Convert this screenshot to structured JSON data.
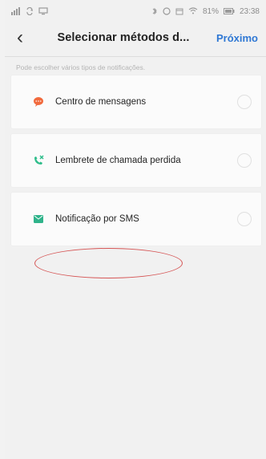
{
  "status_bar": {
    "left_icons": [
      "signal-icon",
      "sync-icon",
      "monitor-icon"
    ],
    "right_icons": [
      "bluetooth-icon",
      "record-icon",
      "calendar-icon",
      "wifi-icon",
      "battery-icon"
    ],
    "battery_percent": "81%",
    "time": "23:38"
  },
  "header": {
    "back_icon": "chevron-left-icon",
    "title": "Selecionar métodos d...",
    "next_label": "Próximo"
  },
  "hint": "Pode escolher vários tipos de notificações.",
  "options": [
    {
      "label": "Centro de mensagens",
      "icon": "message-bubble-icon",
      "icon_color": "#f16a3d"
    },
    {
      "label": "Lembrete de chamada perdida",
      "icon": "missed-call-icon",
      "icon_color": "#2ebd8a"
    },
    {
      "label": "Notificação por SMS",
      "icon": "sms-icon",
      "icon_color": "#2fb38a"
    }
  ],
  "colors": {
    "accent": "#2f78d4",
    "highlight": "#d44c4c"
  }
}
